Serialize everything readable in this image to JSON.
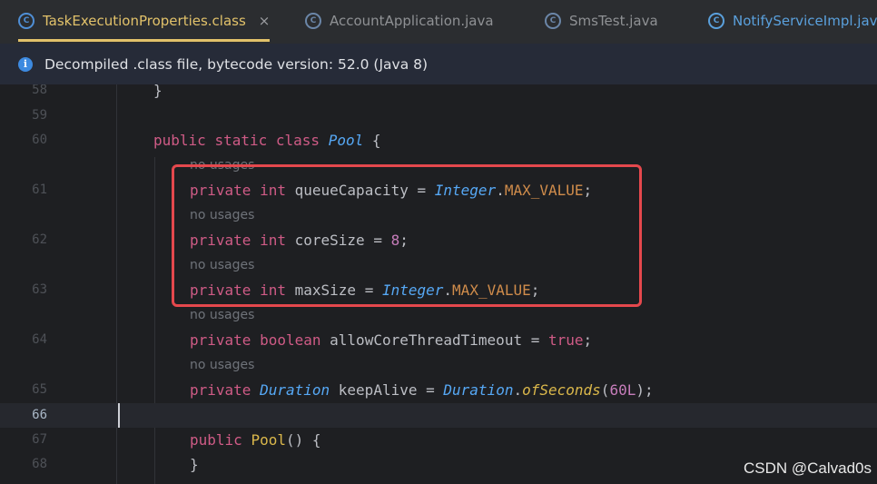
{
  "tabs": [
    {
      "label": "TaskExecutionProperties.class",
      "active": true,
      "close": "×"
    },
    {
      "label": "AccountApplication.java",
      "active": false
    },
    {
      "label": "SmsTest.java",
      "active": false
    },
    {
      "label": "NotifyServiceImpl.java",
      "active": false
    }
  ],
  "banner": {
    "text": "Decompiled .class file, bytecode version: 52.0 (Java 8)"
  },
  "editor": {
    "lines": {
      "l58": "58",
      "l59": "59",
      "l60": "60",
      "l61": "61",
      "l62": "62",
      "l63": "63",
      "l64": "64",
      "l65": "65",
      "l66": "66",
      "l67": "67",
      "l68": "68"
    },
    "hint": "no usages",
    "code": {
      "close_brace_top": "}",
      "public": "public",
      "static": "static",
      "class": "class",
      "pool": "Pool",
      "open_brace": "{",
      "private": "private",
      "int": "int",
      "boolean": "boolean",
      "queueCapacity": "queueCapacity",
      "coreSize": "coreSize",
      "maxSize": "maxSize",
      "allowCoreThreadTimeout": "allowCoreThreadTimeout",
      "keepAlive": "keepAlive",
      "eq": " = ",
      "integer": "Integer",
      "dot": ".",
      "max_value": "MAX_VALUE",
      "semi": ";",
      "eight": "8",
      "true": "true",
      "duration": "Duration",
      "ofSeconds": "ofSeconds",
      "paren_open": "(",
      "sixty": "60L",
      "paren_close": ")",
      "ctor_parens": "() {",
      "close_brace": "}"
    }
  },
  "colors": {
    "highlight": "#e5484d",
    "active_tab": "#e2c26a"
  },
  "watermark": "CSDN @Calvad0s"
}
